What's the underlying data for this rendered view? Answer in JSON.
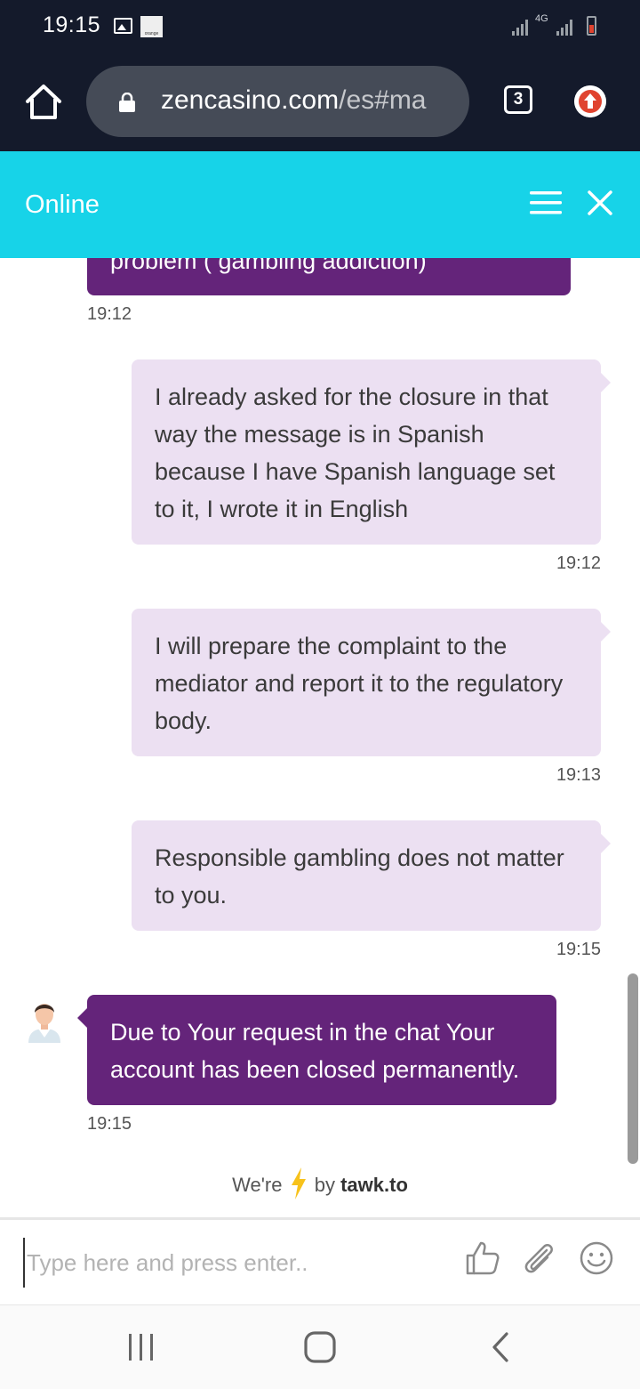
{
  "status_bar": {
    "time": "19:15",
    "carrier_logo_text": "orange",
    "network_type": "4G"
  },
  "browser": {
    "url_domain": "zencasino.com",
    "url_path": "/es#ma",
    "tabs_count": "3"
  },
  "chat_header": {
    "status": "Online"
  },
  "messages": [
    {
      "sender": "agent",
      "text": "problem ( gambling addiction)",
      "time": "19:12"
    },
    {
      "sender": "visitor",
      "text": "I already asked for the closure in that way the message is in Spanish because I have Spanish language set to it, I wrote it in English",
      "time": "19:12"
    },
    {
      "sender": "visitor",
      "text": "I will prepare the complaint to the mediator and report it to the regulatory body.",
      "time": "19:13"
    },
    {
      "sender": "visitor",
      "text": "Responsible gambling does not matter to you.",
      "time": "19:15"
    },
    {
      "sender": "agent",
      "text": "Due to Your request in the chat Your account has been closed permanently.",
      "time": "19:15"
    }
  ],
  "powered_by": {
    "prefix": "We're",
    "middle": "by",
    "brand": "tawk.to"
  },
  "input": {
    "placeholder": "Type here and press enter.."
  },
  "colors": {
    "header_bg": "#17d3e8",
    "agent_bubble": "#64247a",
    "visitor_bubble": "#ece0f2",
    "browser_bg": "#141a2b"
  }
}
